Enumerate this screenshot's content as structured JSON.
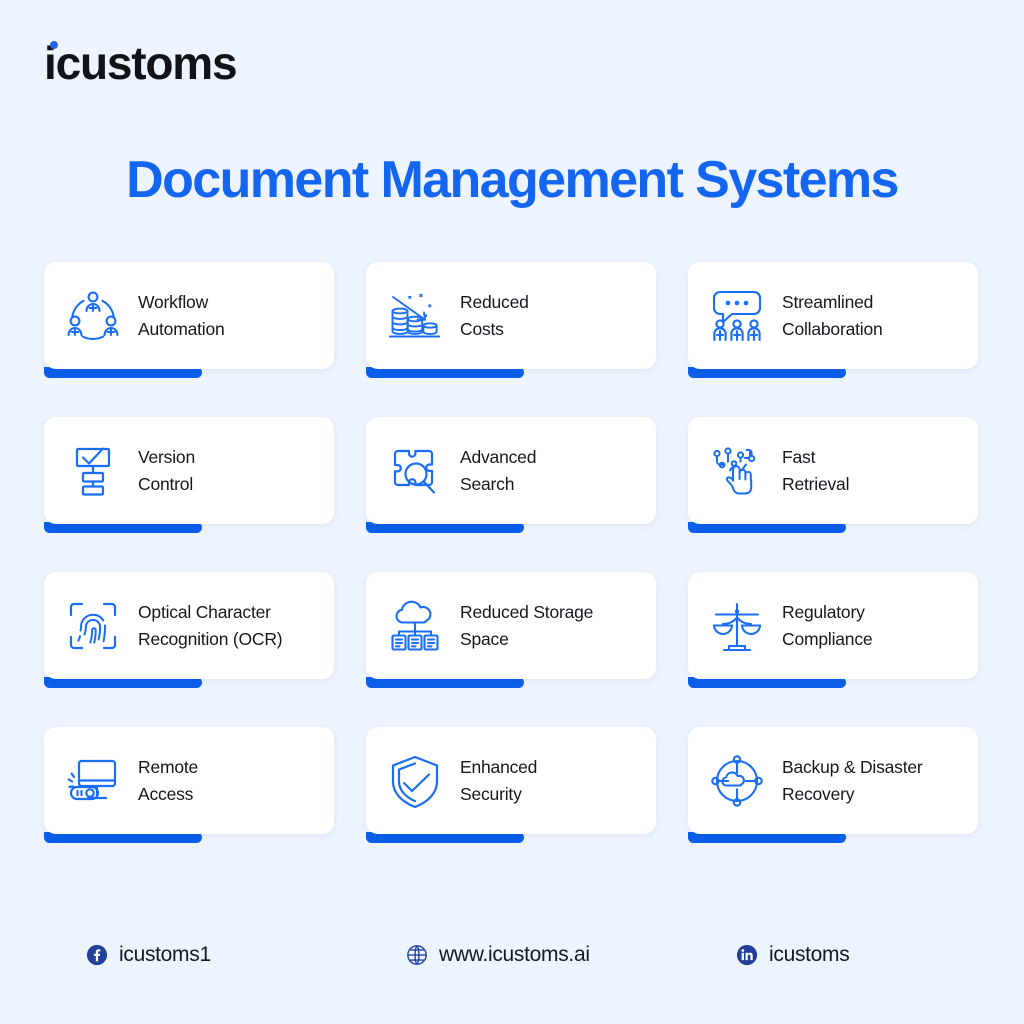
{
  "brand": {
    "logo_text": "icustoms",
    "accent_color": "#1466f0",
    "bar_color": "#0b5fea",
    "background_color": "#eef4fd"
  },
  "header": {
    "title": "Document Management Systems"
  },
  "cards": [
    {
      "icon": "workflow-automation-icon",
      "line1": "Workflow",
      "line2": "Automation"
    },
    {
      "icon": "reduced-costs-icon",
      "line1": "Reduced",
      "line2": "Costs"
    },
    {
      "icon": "streamlined-collaboration-icon",
      "line1": "Streamlined",
      "line2": "Collaboration"
    },
    {
      "icon": "version-control-icon",
      "line1": "Version",
      "line2": "Control"
    },
    {
      "icon": "advanced-search-icon",
      "line1": "Advanced",
      "line2": "Search"
    },
    {
      "icon": "fast-retrieval-icon",
      "line1": "Fast",
      "line2": "Retrieval"
    },
    {
      "icon": "fingerprint-ocr-icon",
      "line1": "Optical Character",
      "line2": "Recognition (OCR)"
    },
    {
      "icon": "cloud-storage-icon",
      "line1": "Reduced Storage",
      "line2": "Space"
    },
    {
      "icon": "regulatory-compliance-icon",
      "line1": "Regulatory",
      "line2": "Compliance"
    },
    {
      "icon": "remote-access-icon",
      "line1": "Remote",
      "line2": "Access"
    },
    {
      "icon": "enhanced-security-icon",
      "line1": "Enhanced",
      "line2": "Security"
    },
    {
      "icon": "backup-recovery-icon",
      "line1": "Backup & Disaster",
      "line2": "Recovery"
    }
  ],
  "footer": {
    "facebook": {
      "icon": "facebook-icon",
      "text": "icustoms1"
    },
    "website": {
      "icon": "globe-icon",
      "text": "www.icustoms.ai"
    },
    "linkedin": {
      "icon": "linkedin-icon",
      "text": "icustoms"
    }
  }
}
